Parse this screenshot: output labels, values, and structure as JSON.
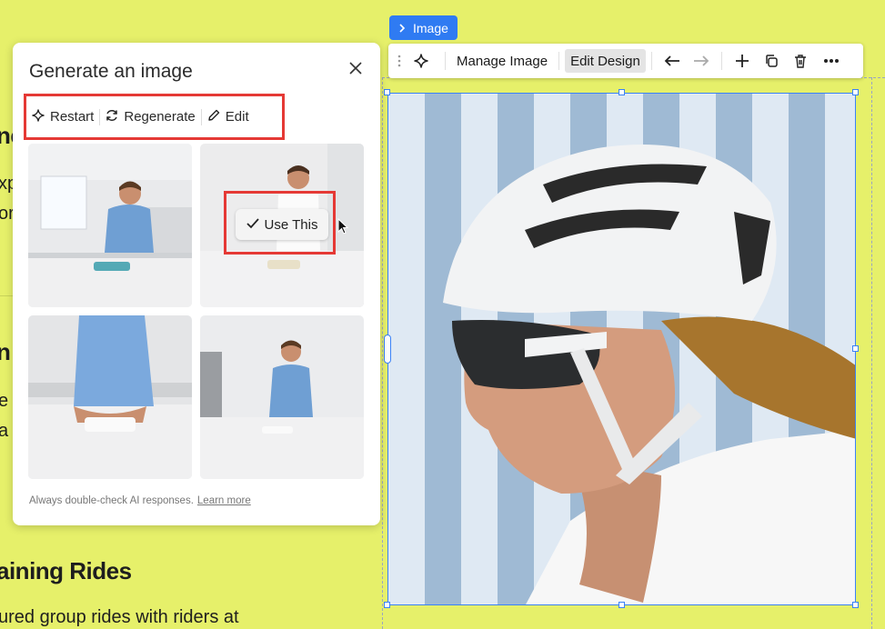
{
  "background_page": {
    "heading_1_fragment": "ne",
    "line_1_fragment": "xp",
    "line_2_fragment": "or",
    "heading_2_fragment": "n",
    "line_3_fragment": "e",
    "line_4_fragment": "a",
    "section_heading": "aining Rides",
    "section_body": "ured group rides with riders at"
  },
  "image_tag": {
    "label": "Image",
    "icon": "chevron-right-icon"
  },
  "toolbar": {
    "drag_icon": "drag-handle-icon",
    "ai_icon": "sparkle-icon",
    "manage_label": "Manage Image",
    "edit_design_label": "Edit Design",
    "undo_icon": "arrow-left-icon",
    "redo_icon": "arrow-right-icon",
    "add_icon": "plus-icon",
    "duplicate_icon": "duplicate-icon",
    "delete_icon": "trash-icon",
    "more_icon": "more-icon"
  },
  "panel": {
    "title": "Generate an image",
    "actions": {
      "restart": "Restart",
      "regenerate": "Regenerate",
      "edit": "Edit"
    },
    "use_this_label": "Use This",
    "footer_text": "Always double-check AI responses.",
    "footer_link": "Learn more"
  },
  "colors": {
    "page_background": "#e6f06a",
    "accent_blue": "#2f7bf2",
    "highlight_red": "#e53935"
  }
}
